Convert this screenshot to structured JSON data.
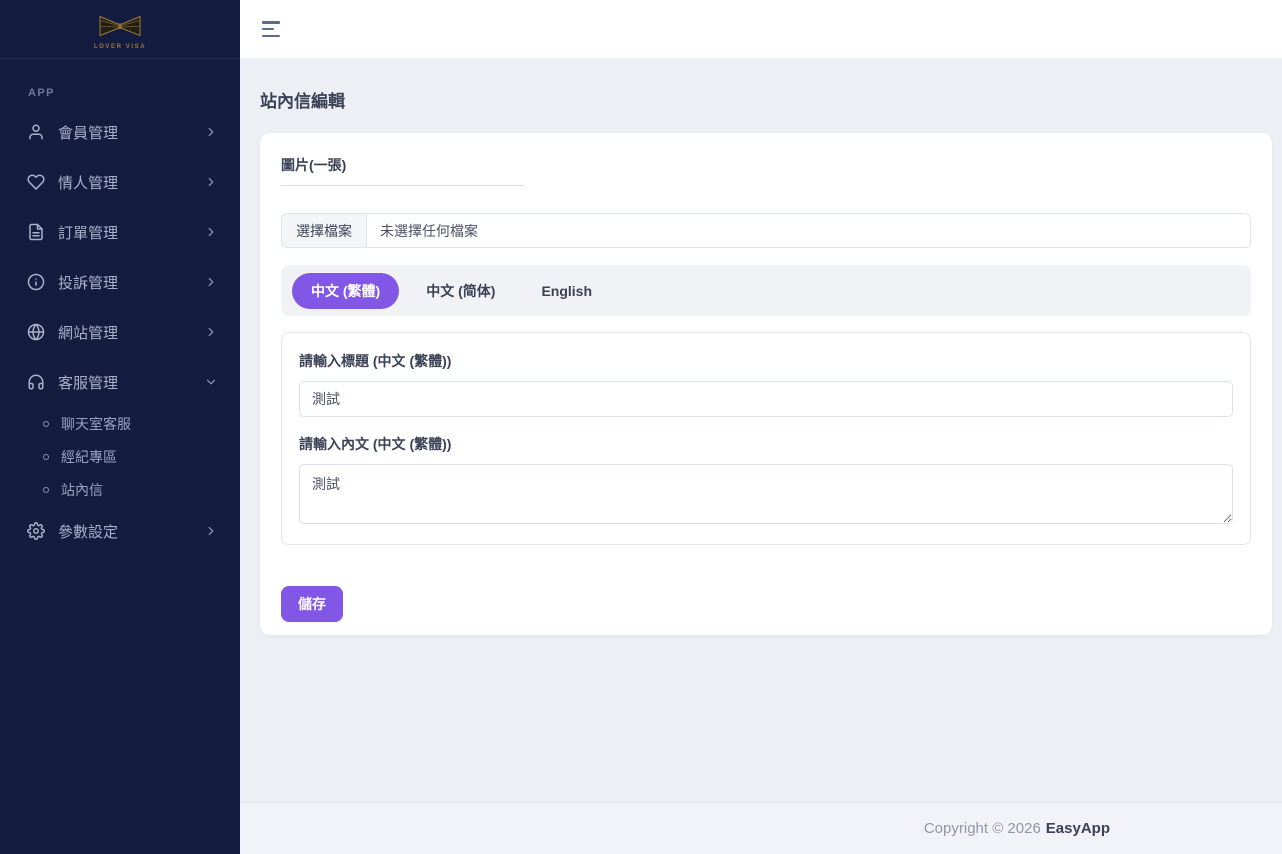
{
  "sidebar": {
    "logo": {
      "brand": "LOVER VISA"
    },
    "section_label": "APP",
    "items": [
      {
        "label": "會員管理",
        "icon": "user-icon",
        "chevron": "right"
      },
      {
        "label": "情人管理",
        "icon": "heart-icon",
        "chevron": "right"
      },
      {
        "label": "訂單管理",
        "icon": "document-icon",
        "chevron": "right"
      },
      {
        "label": "投訴管理",
        "icon": "info-circle-icon",
        "chevron": "right"
      },
      {
        "label": "網站管理",
        "icon": "globe-icon",
        "chevron": "right"
      },
      {
        "label": "客服管理",
        "icon": "headset-icon",
        "chevron": "down",
        "expanded": true,
        "children": [
          "聊天室客服",
          "經紀專區",
          "站內信"
        ]
      },
      {
        "label": "參數設定",
        "icon": "gear-icon",
        "chevron": "right"
      }
    ]
  },
  "page": {
    "title": "站內信編輯"
  },
  "form": {
    "image_label": "圖片(一張)",
    "file_input": {
      "button": "選擇檔案",
      "status": "未選擇任何檔案"
    },
    "tabs": [
      {
        "label": "中文 (繁體)",
        "active": true
      },
      {
        "label": "中文 (简体)",
        "active": false
      },
      {
        "label": "English",
        "active": false
      }
    ],
    "title_label": "請輸入標題 (中文 (繁體))",
    "title_value": "測試",
    "content_label": "請輸入內文 (中文 (繁體))",
    "content_value": "測試",
    "save_label": "儲存"
  },
  "footer": {
    "copyright_text": "Copyright © 2026",
    "brand": "EasyApp"
  },
  "colors": {
    "accent": "#8257e5",
    "sidebar_bg": "#141d40",
    "content_bg": "#edeff4"
  }
}
